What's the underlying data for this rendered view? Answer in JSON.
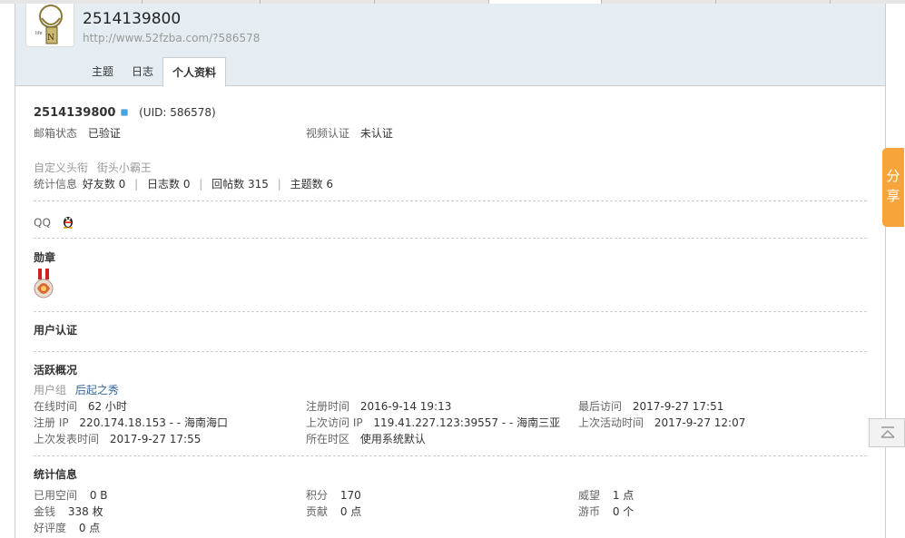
{
  "header": {
    "username": "2514139800",
    "space_url": "http://www.52fzba.com/?586578",
    "tabs": [
      {
        "label": "主题"
      },
      {
        "label": "日志"
      },
      {
        "label": "个人资料"
      }
    ]
  },
  "profile": {
    "username": "2514139800",
    "uid_text": "(UID: 586578)",
    "email_status_label": "邮箱状态",
    "email_status_value": "已验证",
    "video_auth_label": "视频认证",
    "video_auth_value": "未认证",
    "custom_title_label": "自定义头衔",
    "custom_title_value": "街头小霸王",
    "stats": {
      "label": "统计信息",
      "friends": "好友数 0",
      "blogs": "日志数 0",
      "replies": "回帖数 315",
      "threads": "主题数 6"
    },
    "qq_label": "QQ"
  },
  "sections": {
    "medals": "勋章",
    "verification": "用户认证",
    "activity": "活跃概况",
    "statistics": "统计信息"
  },
  "activity": {
    "usergroup_label": "用户组",
    "usergroup_value": "后起之秀",
    "online_label": "在线时间",
    "online_value": "62 小时",
    "reg_time_label": "注册时间",
    "reg_time_value": "2016-9-14 19:13",
    "last_visit_label": "最后访问",
    "last_visit_value": "2017-9-27 17:51",
    "reg_ip_label": "注册 IP",
    "reg_ip_value": "220.174.18.153 - - 海南海口",
    "last_ip_label": "上次访问 IP",
    "last_ip_value": "119.41.227.123:39557 - - 海南三亚",
    "last_active_label": "上次活动时间",
    "last_active_value": "2017-9-27 12:07",
    "last_post_label": "上次发表时间",
    "last_post_value": "2017-9-27 17:55",
    "timezone_label": "所在时区",
    "timezone_value": "使用系统默认"
  },
  "statistics": {
    "space_label": "已用空间",
    "space_value": "0 B",
    "points_label": "积分",
    "points_value": "170",
    "prestige_label": "威望",
    "prestige_value": "1 点",
    "money_label": "金钱",
    "money_value": "338 枚",
    "contribution_label": "贡献",
    "contribution_value": "0 点",
    "coins_label": "游币",
    "coins_value": "0 个",
    "rating_label": "好评度",
    "rating_value": "0 点"
  },
  "floating": {
    "share_label": "分享"
  },
  "colors": {
    "header_bg": "#e5edf2",
    "link": "#336699",
    "share_bg": "#f7a53b",
    "online_dot": "#3ea7e4"
  }
}
